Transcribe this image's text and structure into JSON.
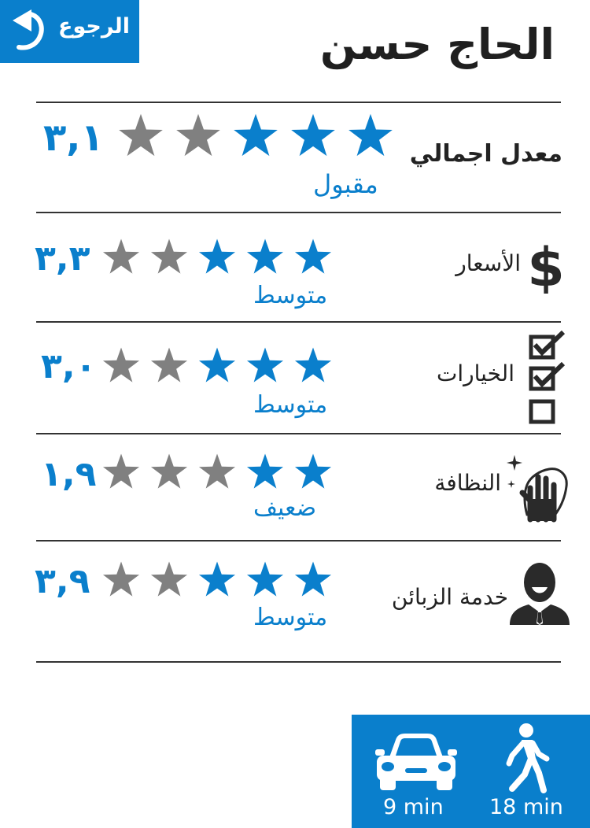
{
  "header": {
    "back_label": "الرجوع",
    "title": "الحاج حسن"
  },
  "colors": {
    "accent": "#0a7fcc",
    "star_empty": "#808080"
  },
  "overall": {
    "label": "معدل اجمالي",
    "score": "٣,١",
    "rating_stars": 3,
    "quality": "مقبول"
  },
  "categories": [
    {
      "label": "الأسعار",
      "icon": "dollar-icon",
      "score": "٣,٣",
      "rating_stars": 3,
      "quality": "متوسط"
    },
    {
      "label": "الخيارات",
      "icon": "checklist-icon",
      "score": "٣,٠",
      "rating_stars": 3,
      "quality": "متوسط"
    },
    {
      "label": "النظافة",
      "icon": "cleaning-hand-icon",
      "score": "١,٩",
      "rating_stars": 2,
      "quality": "ضعيف"
    },
    {
      "label": "خدمة الزبائن",
      "icon": "customer-service-icon",
      "score": "٣,٩",
      "rating_stars": 3,
      "quality": "متوسط"
    }
  ],
  "travel": {
    "car_time": "9 min",
    "walk_time": "18 min",
    "car_icon": "car-icon",
    "walk_icon": "walking-person-icon"
  }
}
